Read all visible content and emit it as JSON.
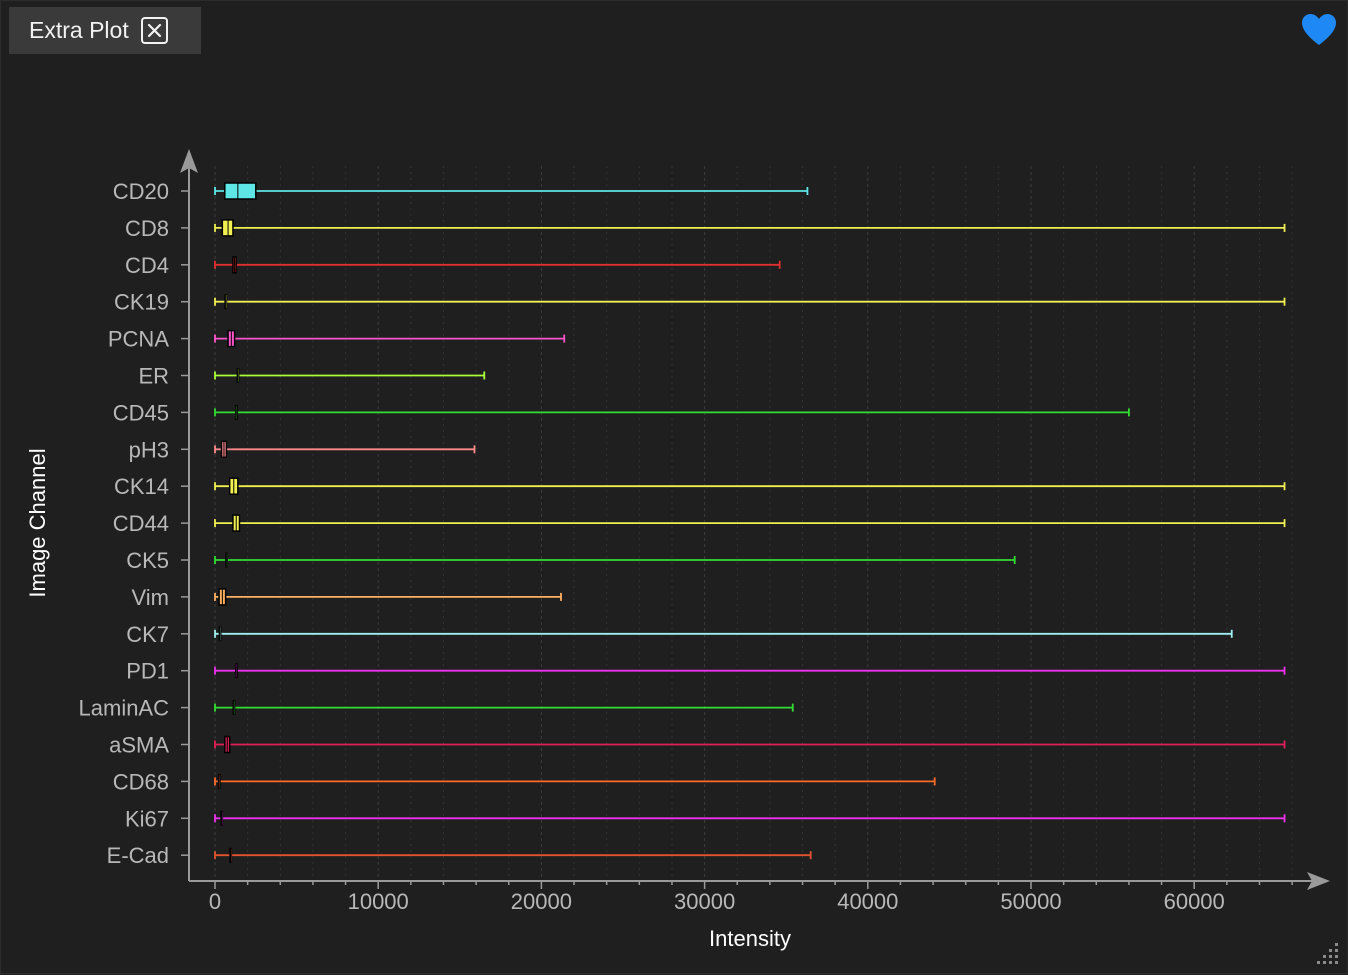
{
  "window": {
    "tab_title": "Extra Plot",
    "close_icon": "close-icon",
    "favorite_icon": "heart-icon",
    "favorite_color": "#1e88f5",
    "resize_icon": "resize-grip-icon"
  },
  "chart_data": {
    "type": "box",
    "orientation": "horizontal",
    "xlabel": "Intensity",
    "ylabel": "Image Channel",
    "xlim": [
      -1600,
      68500
    ],
    "xticks": [
      0,
      10000,
      20000,
      30000,
      40000,
      50000,
      60000
    ],
    "xtick_labels": [
      "0",
      "10000",
      "20000",
      "30000",
      "40000",
      "50000",
      "60000"
    ],
    "grid": "vertical dashed",
    "categories": [
      "CD20",
      "CD8",
      "CD4",
      "CK19",
      "PCNA",
      "ER",
      "CD45",
      "pH3",
      "CK14",
      "CD44",
      "CK5",
      "Vim",
      "CK7",
      "PD1",
      "LaminAC",
      "aSMA",
      "CD68",
      "Ki67",
      "E-Cad"
    ],
    "series": [
      {
        "label": "CD20",
        "color": "#5ee6e6",
        "min": 0,
        "q1": 600,
        "median": 1400,
        "q3": 2500,
        "max": 36300
      },
      {
        "label": "CD8",
        "color": "#f0f050",
        "min": 0,
        "q1": 450,
        "median": 800,
        "q3": 1100,
        "max": 65535
      },
      {
        "label": "CD4",
        "color": "#e03030",
        "min": 0,
        "q1": 1100,
        "median": 1200,
        "q3": 1300,
        "max": 34600
      },
      {
        "label": "CK19",
        "color": "#f0f050",
        "min": 0,
        "q1": 600,
        "median": 650,
        "q3": 700,
        "max": 65535
      },
      {
        "label": "PCNA",
        "color": "#ff55cc",
        "min": 0,
        "q1": 800,
        "median": 1000,
        "q3": 1200,
        "max": 21400
      },
      {
        "label": "ER",
        "color": "#a8ff3a",
        "min": 0,
        "q1": 1350,
        "median": 1400,
        "q3": 1450,
        "max": 16500
      },
      {
        "label": "CD45",
        "color": "#33dd33",
        "min": 0,
        "q1": 1250,
        "median": 1300,
        "q3": 1350,
        "max": 56000
      },
      {
        "label": "pH3",
        "color": "#ff8a8a",
        "min": 0,
        "q1": 400,
        "median": 550,
        "q3": 700,
        "max": 15900
      },
      {
        "label": "CK14",
        "color": "#f0f050",
        "min": 0,
        "q1": 900,
        "median": 1150,
        "q3": 1400,
        "max": 65535
      },
      {
        "label": "CD44",
        "color": "#f0f050",
        "min": 0,
        "q1": 1100,
        "median": 1300,
        "q3": 1500,
        "max": 65535
      },
      {
        "label": "CK5",
        "color": "#33dd33",
        "min": 0,
        "q1": 650,
        "median": 700,
        "q3": 750,
        "max": 49000
      },
      {
        "label": "Vim",
        "color": "#ffb060",
        "min": 0,
        "q1": 250,
        "median": 450,
        "q3": 650,
        "max": 21200
      },
      {
        "label": "CK7",
        "color": "#9ff0f0",
        "min": 0,
        "q1": 250,
        "median": 300,
        "q3": 350,
        "max": 62300
      },
      {
        "label": "PD1",
        "color": "#ee33ee",
        "min": 0,
        "q1": 1250,
        "median": 1300,
        "q3": 1350,
        "max": 65535
      },
      {
        "label": "LaminAC",
        "color": "#33dd33",
        "min": 0,
        "q1": 1100,
        "median": 1150,
        "q3": 1200,
        "max": 35400
      },
      {
        "label": "aSMA",
        "color": "#e0205a",
        "min": 0,
        "q1": 600,
        "median": 750,
        "q3": 900,
        "max": 65535
      },
      {
        "label": "CD68",
        "color": "#ff6a2a",
        "min": 0,
        "q1": 200,
        "median": 250,
        "q3": 300,
        "max": 44100
      },
      {
        "label": "Ki67",
        "color": "#ee33ee",
        "min": 0,
        "q1": 350,
        "median": 400,
        "q3": 450,
        "max": 65535
      },
      {
        "label": "E-Cad",
        "color": "#e05530",
        "min": 0,
        "q1": 900,
        "median": 950,
        "q3": 1000,
        "max": 36500
      }
    ]
  }
}
